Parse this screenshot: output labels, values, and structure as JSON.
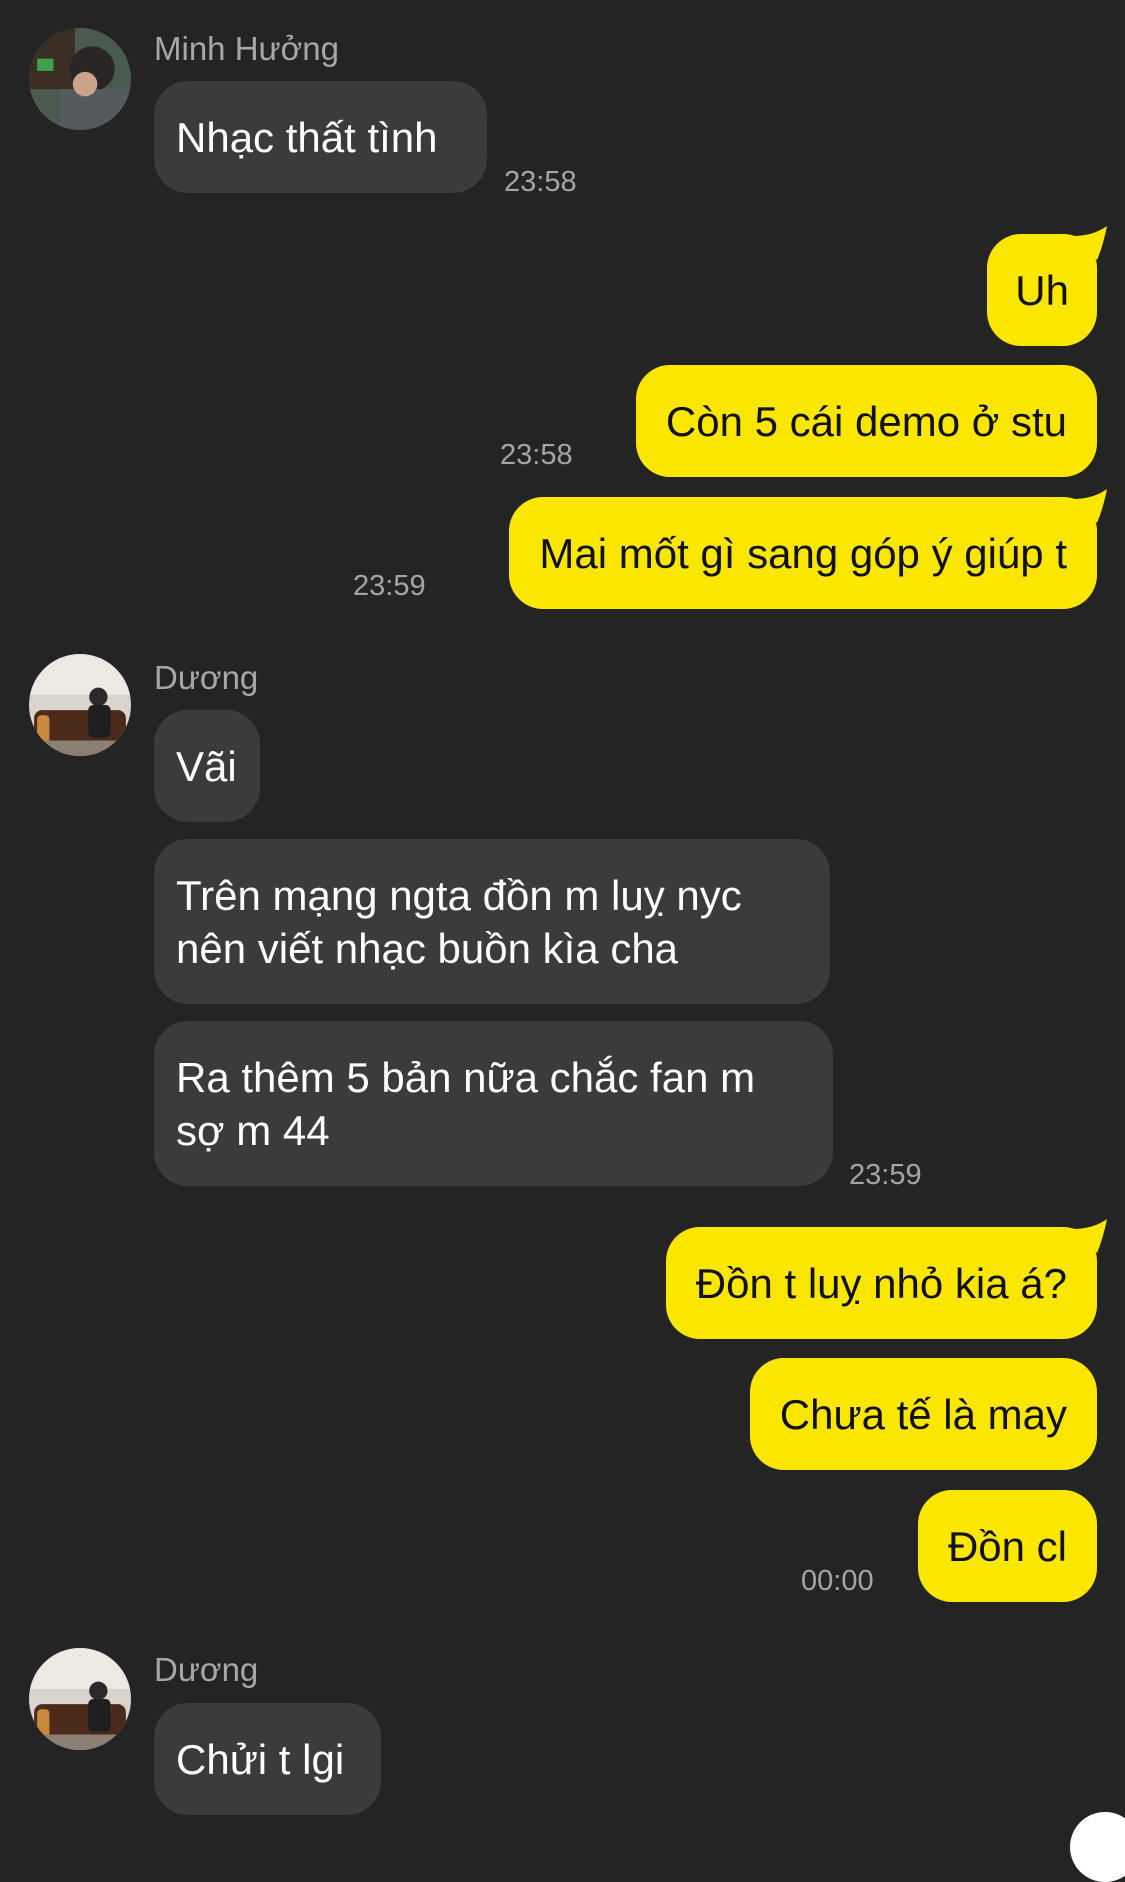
{
  "conversation": [
    {
      "sender": "Minh Hưởng",
      "avatar": "avatar-minh-huong",
      "messages": [
        "Nhạc thất tình"
      ],
      "time": "23:58"
    },
    {
      "sender": "me",
      "messages": [
        "Uh",
        "Còn 5 cái demo ở stu"
      ],
      "time": "23:58"
    },
    {
      "sender": "me",
      "messages": [
        "Mai mốt gì sang góp ý giúp t"
      ],
      "time": "23:59"
    },
    {
      "sender": "Dương",
      "avatar": "avatar-duong",
      "messages": [
        "Vãi",
        "Trên mạng ngta đồn m luỵ nyc\nnên viết nhạc buồn kìa cha",
        "Ra thêm 5 bản nữa chắc fan m\nsợ m 44"
      ],
      "time": "23:59"
    },
    {
      "sender": "me",
      "messages": [
        "Đồn t luỵ nhỏ kia á?",
        "Chưa tế là may",
        "Đồn cl"
      ],
      "time": "00:00"
    },
    {
      "sender": "Dương",
      "avatar": "avatar-duong",
      "messages": [
        "Chửi t lgi"
      ]
    }
  ],
  "texts": {
    "g1_sender": "Minh Hưởng",
    "g1_m1": "Nhạc thất tình",
    "g1_time": "23:58",
    "g2_m1": "Uh",
    "g2_m2": "Còn 5 cái demo ở stu",
    "g2_time": "23:58",
    "g3_m1": "Mai mốt gì sang góp ý giúp t",
    "g3_time": "23:59",
    "g4_sender": "Dương",
    "g4_m1": "Vãi",
    "g4_m2_l1": "Trên mạng ngta đồn m luỵ nyc",
    "g4_m2_l2": "nên viết nhạc buồn kìa cha",
    "g4_m3_l1": "Ra thêm 5 bản nữa chắc fan m",
    "g4_m3_l2": "sợ m 44",
    "g4_time": "23:59",
    "g5_m1": "Đồn t luỵ nhỏ kia á?",
    "g5_m2": "Chưa tế là may",
    "g5_m3": "Đồn cl",
    "g5_time": "00:00",
    "g6_sender": "Dương",
    "g6_m1": "Chửi t lgi"
  },
  "colors": {
    "background": "#242424",
    "incoming_bubble": "#3b3b3d",
    "outgoing_bubble": "#fbe600",
    "timestamp": "#a5a5a5"
  }
}
